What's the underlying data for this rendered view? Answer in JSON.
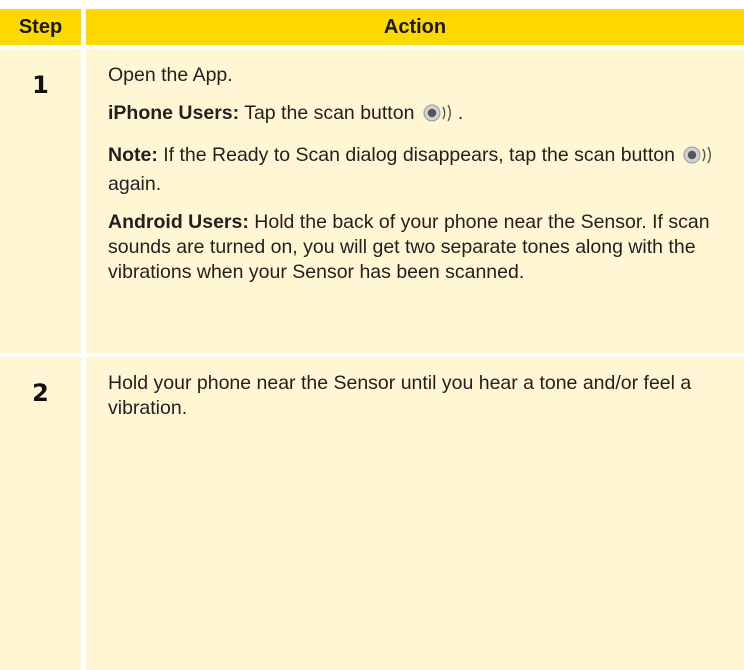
{
  "header": {
    "step": "Step",
    "action": "Action"
  },
  "rows": [
    {
      "step": "1",
      "open_app": "Open the App.",
      "iphone_label": "iPhone Users:",
      "iphone_text": "Tap the scan button",
      "iphone_end": ".",
      "note_label": "Note:",
      "note_text": "If the Ready to Scan dialog disappears, tap the scan button",
      "note_end": "again.",
      "android_label": "Android Users:",
      "android_text": "Hold the back of your phone near the Sensor. If scan sounds are turned on, you will get two separate tones along with the vibrations when your Sensor has been scanned."
    },
    {
      "step": "2",
      "text": "Hold your phone near the Sensor until you hear a tone and/or feel a vibration."
    }
  ],
  "icons": {
    "scan": "scan-button-icon"
  },
  "colors": {
    "header_bg": "#ffd800",
    "cell_bg": "#fff6d4"
  }
}
